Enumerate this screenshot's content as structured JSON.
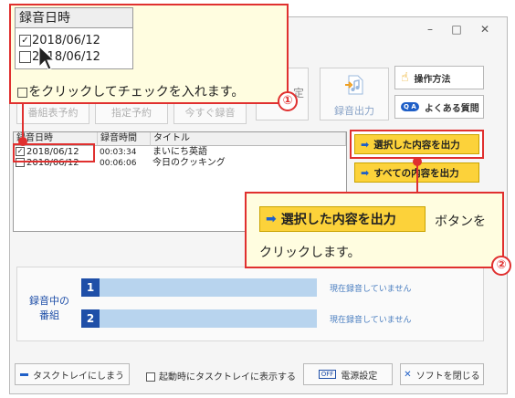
{
  "window": {
    "controls": {
      "minimize": "–",
      "maximize": "□",
      "close": "✕"
    }
  },
  "top_tabs": {
    "program_list": "番組表予約",
    "designated": "指定予約",
    "record_now": "今すぐ録音",
    "partial": "定"
  },
  "rec_output": {
    "label": "録音出力",
    "icon": "music-file-icon"
  },
  "help": {
    "how_to": "操作方法",
    "faq": "よくある質問",
    "faq_badge": "Q A"
  },
  "list": {
    "headers": [
      "録音日時",
      "録音時間",
      "タイトル"
    ],
    "rows": [
      {
        "checked": true,
        "date": "2018/06/12",
        "duration": "00:03:34",
        "title": "まいにち英語"
      },
      {
        "checked": false,
        "date": "2018/06/12",
        "duration": "00:06:06",
        "title": "今日のクッキング"
      }
    ]
  },
  "output_buttons": {
    "selected": "選択した内容を出力",
    "all": "すべての内容を出力",
    "arrow": "➡"
  },
  "callout1": {
    "header": "録音日時",
    "rows": [
      {
        "checked": true,
        "date": "2018/06/12"
      },
      {
        "checked": false,
        "date": "2018/06/12"
      }
    ],
    "text": "□をクリックしてチェックを入れます。",
    "number": "①"
  },
  "callout2": {
    "button": "選択した内容を出力",
    "text_a": "ボタンを",
    "text_b": "クリックします。",
    "number": "②"
  },
  "recording": {
    "label_line1": "録音中の",
    "label_line2": "番組",
    "slots": [
      {
        "num": "1",
        "status": "現在録音していません"
      },
      {
        "num": "2",
        "status": "現在録音していません"
      }
    ]
  },
  "bottom": {
    "tasktray": "タスクトレイにしまう",
    "startup": "起動時にタスクトレイに表示する",
    "power": "電源設定",
    "power_icon": "OFF",
    "close": "ソフトを閉じる"
  },
  "colors": {
    "accent_red": "#e0302f",
    "button_yellow": "#fcd23a",
    "slot_blue": "#1f4fa8"
  }
}
